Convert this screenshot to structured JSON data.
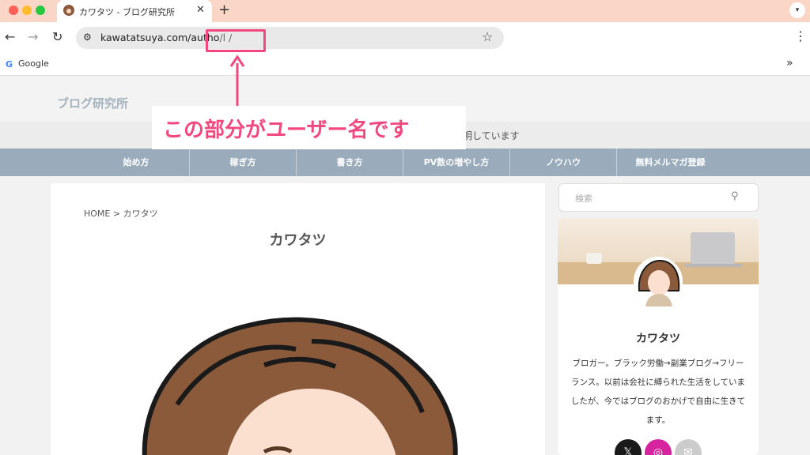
{
  "browser": {
    "tab_title": "カワタツ - ブログ研究所",
    "tab_close": "✕",
    "new_tab": "+",
    "url_prefix": "kawatatsuya.com/autho",
    "url_suffix": "/l            /",
    "bookmark": "Google"
  },
  "site": {
    "logo": "ブログ研究所",
    "tagline": "明しています",
    "menu": [
      "始め方",
      "稼ぎ方",
      "書き方",
      "PV数の増やし方",
      "ノウハウ",
      "無料メルマガ登録"
    ]
  },
  "content": {
    "breadcrumb": "HOME > カワタツ",
    "title": "カワタツ"
  },
  "sidebar": {
    "search_placeholder": "検索",
    "profile_name": "カワタツ",
    "profile_bio": "ブロガー。ブラック労働→副業ブログ→フリーランス。以前は会社に縛られた生活をしていましたが、今ではブログのおかげで自由に生きてます。"
  },
  "annotation": {
    "text": "この部分がユーザー名です",
    "color": "#f0487f"
  }
}
